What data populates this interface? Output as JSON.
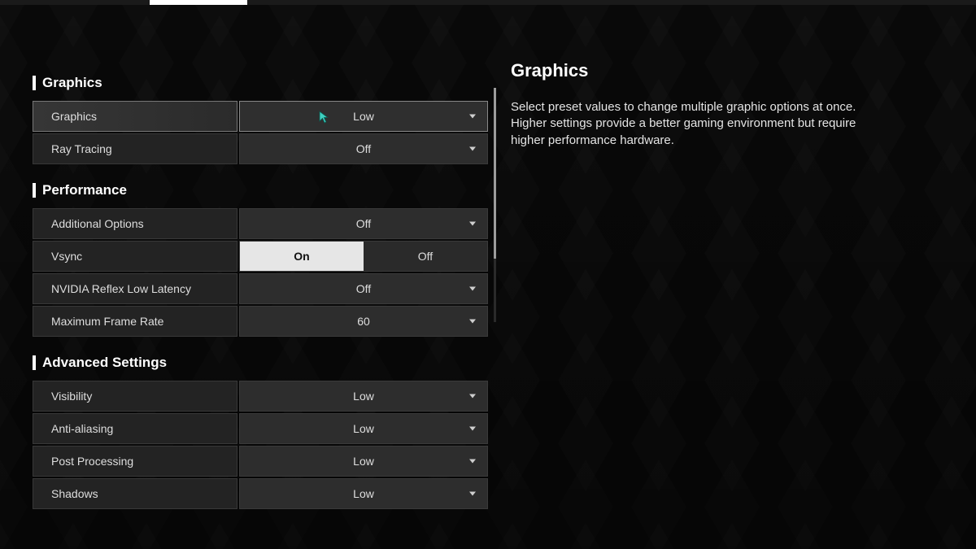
{
  "right": {
    "title": "Graphics",
    "desc": "Select preset values to change multiple graphic options at once.\nHigher settings provide a better gaming environment but require higher performance hardware."
  },
  "sections": {
    "graphics": {
      "title": "Graphics",
      "rows": {
        "graphics": {
          "label": "Graphics",
          "value": "Low"
        },
        "rayTracing": {
          "label": "Ray Tracing",
          "value": "Off"
        }
      }
    },
    "performance": {
      "title": "Performance",
      "rows": {
        "additional": {
          "label": "Additional Options",
          "value": "Off"
        },
        "vsync": {
          "label": "Vsync",
          "on": "On",
          "off": "Off"
        },
        "reflex": {
          "label": "NVIDIA Reflex Low Latency",
          "value": "Off"
        },
        "maxfps": {
          "label": "Maximum Frame Rate",
          "value": "60"
        }
      }
    },
    "advanced": {
      "title": "Advanced Settings",
      "rows": {
        "visibility": {
          "label": "Visibility",
          "value": "Low"
        },
        "aa": {
          "label": "Anti-aliasing",
          "value": "Low"
        },
        "post": {
          "label": "Post Processing",
          "value": "Low"
        },
        "shadows": {
          "label": "Shadows",
          "value": "Low"
        }
      }
    }
  }
}
